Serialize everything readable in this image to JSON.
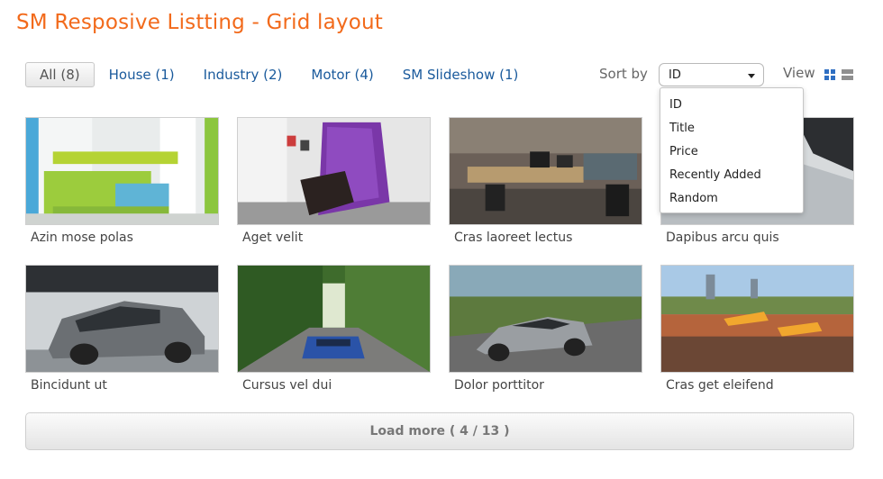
{
  "title": "SM Resposive Listting - Grid layout",
  "filters": [
    {
      "label": "All (8)",
      "active": true
    },
    {
      "label": "House (1)"
    },
    {
      "label": "Industry (2)"
    },
    {
      "label": "Motor (4)"
    },
    {
      "label": "SM Slideshow (1)"
    }
  ],
  "sort": {
    "label": "Sort by",
    "selected": "ID",
    "options": [
      "ID",
      "Title",
      "Price",
      "Recently Added",
      "Random"
    ]
  },
  "view": {
    "label": "View"
  },
  "items": [
    {
      "caption": "Azin mose polas"
    },
    {
      "caption": "Aget velit"
    },
    {
      "caption": "Cras laoreet lectus"
    },
    {
      "caption": "Dapibus arcu quis"
    },
    {
      "caption": "Bincidunt ut"
    },
    {
      "caption": "Cursus vel dui"
    },
    {
      "caption": "Dolor porttitor"
    },
    {
      "caption": "Cras get eleifend"
    }
  ],
  "load_more": "Load more ( 4 / 13 )",
  "colors": {
    "title": "#f26a1b",
    "link": "#1a5a9c",
    "view_active": "#2f6fc2"
  }
}
